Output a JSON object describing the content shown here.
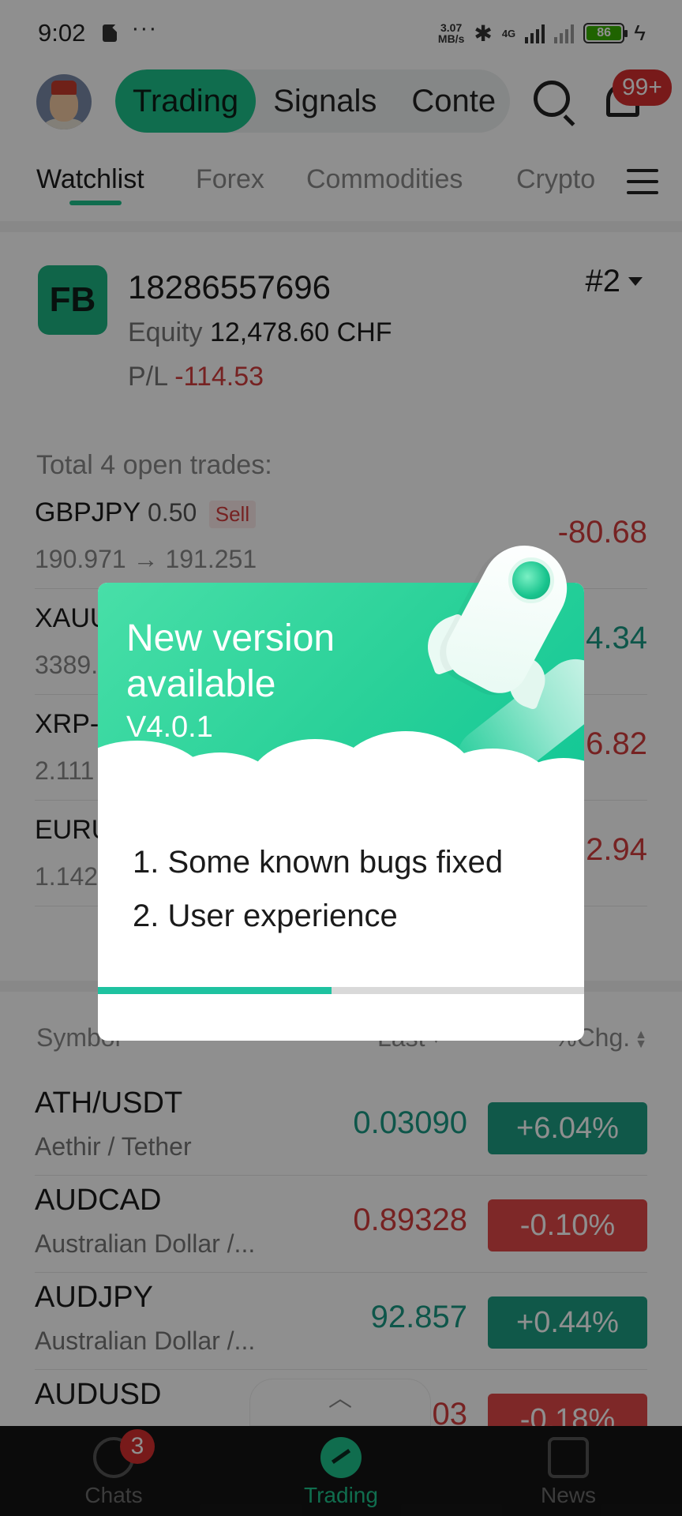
{
  "status_bar": {
    "time": "9:02",
    "dots": "···",
    "net_speed_value": "3.07",
    "net_speed_unit": "MB/s",
    "network": "4G",
    "battery": "86"
  },
  "top_bar": {
    "segments": [
      "Trading",
      "Signals",
      "Conte"
    ],
    "notifications_badge": "99+"
  },
  "category_tabs": [
    "Watchlist",
    "Forex",
    "Commodities",
    "Crypto"
  ],
  "account": {
    "logo": "FB",
    "number": "18286557696",
    "equity_label": "Equity",
    "equity_value": "12,478.60 CHF",
    "pl_label": "P/L",
    "pl_value": "-114.53",
    "index": "#2"
  },
  "trades": {
    "title": "Total 4 open trades:",
    "rows": [
      {
        "symbol": "GBPJPY",
        "lot": "0.50",
        "side": "Sell",
        "price": "190.971 → 191.251",
        "pl": "-80.68"
      },
      {
        "symbol": "XAUU",
        "price": "3389.",
        "pl": "4.34"
      },
      {
        "symbol": "XRP-",
        "price": "2.111",
        "pl": "6.82"
      },
      {
        "symbol": "EURU",
        "price": "1.142",
        "pl": "2.94"
      }
    ]
  },
  "quotes_header": {
    "symbol": "Symbol",
    "last": "Last",
    "change": "%Chg."
  },
  "quotes": [
    {
      "symbol": "ATH/USDT",
      "desc": "Aethir / Tether",
      "last": "0.03090",
      "change": "+6.04%",
      "direction": "up"
    },
    {
      "symbol": "AUDCAD",
      "desc": "Australian Dollar /...",
      "last": "0.89328",
      "change": "-0.10%",
      "direction": "down"
    },
    {
      "symbol": "AUDJPY",
      "desc": "Australian Dollar /...",
      "last": "92.857",
      "change": "+0.44%",
      "direction": "up"
    },
    {
      "symbol": "AUDUSD",
      "desc": "",
      "last": "03",
      "change": "-0.18%",
      "direction": "down"
    }
  ],
  "bottom_nav": {
    "chats": "Chats",
    "chats_badge": "3",
    "trading": "Trading",
    "news": "News"
  },
  "update_dialog": {
    "title": "New version available",
    "version": "V4.0.1",
    "notes": [
      "1. Some known bugs fixed",
      "2. User experience"
    ],
    "progress": 0.48
  },
  "colors": {
    "accent": "#1ec28b",
    "negative": "#d33d3d",
    "positive": "#1a9a84",
    "dim": "rgba(0,0,0,0.44)"
  }
}
